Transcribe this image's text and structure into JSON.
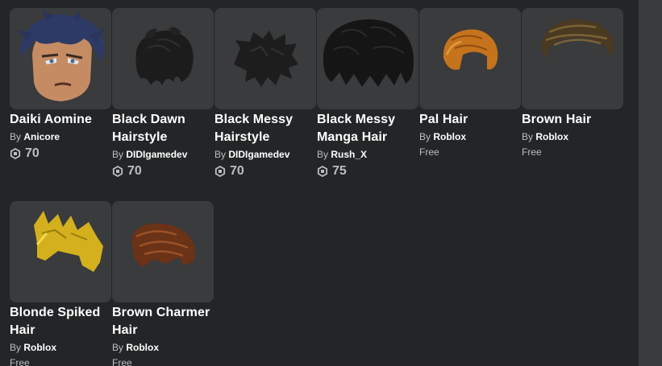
{
  "items": [
    {
      "name": "Daiki Aomine",
      "by_prefix": "By",
      "creator": "Anicore",
      "price": "70",
      "currency_icon": "robux-icon"
    },
    {
      "name": "Black Dawn Hairstyle",
      "by_prefix": "By",
      "creator": "DIDIgamedev",
      "price": "70",
      "currency_icon": "robux-icon"
    },
    {
      "name": "Black Messy Hairstyle",
      "by_prefix": "By",
      "creator": "DIDIgamedev",
      "price": "70",
      "currency_icon": "robux-icon"
    },
    {
      "name": "Black Messy Manga Hair",
      "by_prefix": "By",
      "creator": "Rush_X",
      "price": "75",
      "currency_icon": "robux-icon"
    },
    {
      "name": "Pal Hair",
      "by_prefix": "By",
      "creator": "Roblox",
      "price_text": "Free"
    },
    {
      "name": "Brown Hair",
      "by_prefix": "By",
      "creator": "Roblox",
      "price_text": "Free"
    },
    {
      "name": "Blonde Spiked Hair",
      "by_prefix": "By",
      "creator": "Roblox",
      "price_text": "Free"
    },
    {
      "name": "Brown Charmer Hair",
      "by_prefix": "By",
      "creator": "Roblox",
      "price_text": "Free"
    }
  ],
  "colors": {
    "background": "#232527",
    "card": "#393b3d",
    "text_primary": "#ffffff",
    "text_secondary": "#bdbebe"
  }
}
